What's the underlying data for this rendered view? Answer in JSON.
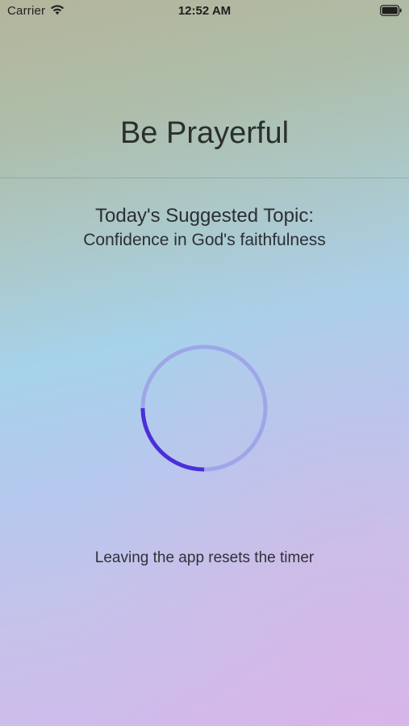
{
  "status_bar": {
    "carrier": "Carrier",
    "time": "12:52 AM",
    "wifi_icon": "wifi-icon",
    "battery_icon": "battery-icon"
  },
  "app": {
    "title": "Be Prayerful"
  },
  "topic": {
    "heading": "Today's Suggested Topic:",
    "text": "Confidence in God's faithfulness"
  },
  "timer": {
    "progress": 0.25,
    "track_color": "#9da7e8",
    "progress_color": "#4a2fd9"
  },
  "footer": {
    "note": "Leaving the app resets the timer"
  },
  "colors": {
    "text_primary": "#2b2f2d"
  }
}
